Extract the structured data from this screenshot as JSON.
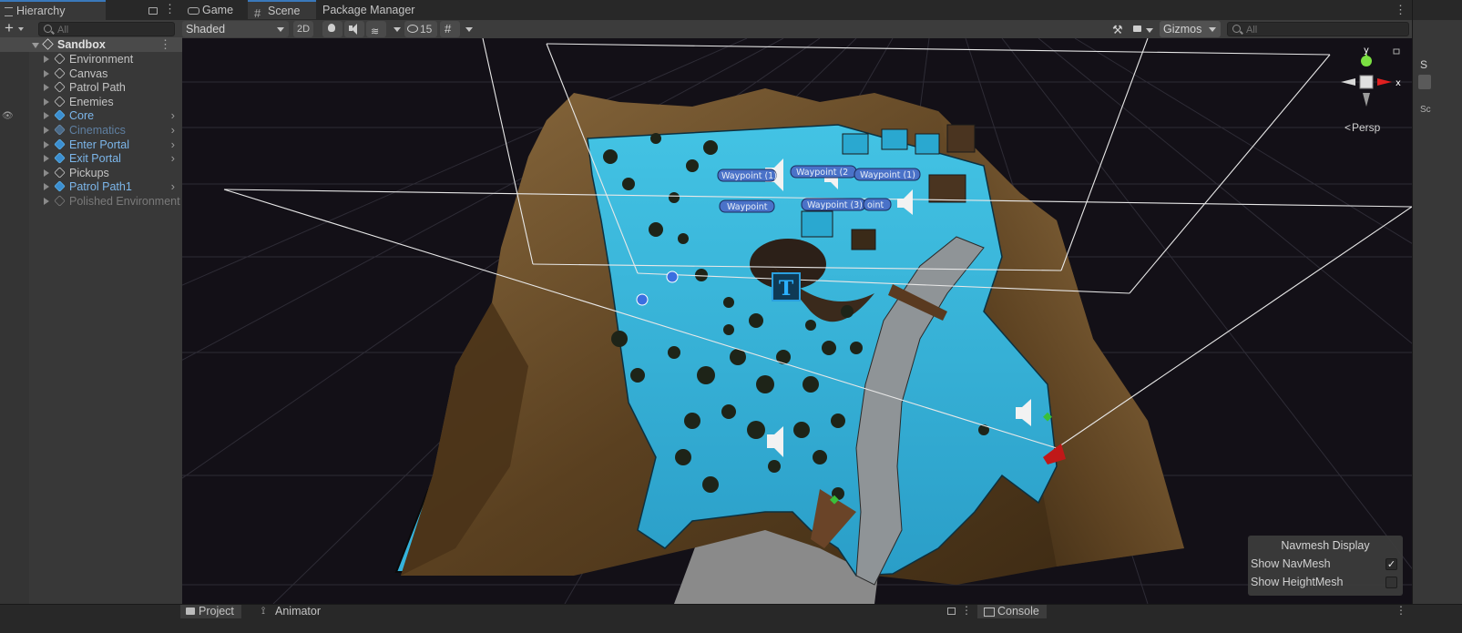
{
  "hierarchy": {
    "tab_label": "Hierarchy",
    "search_placeholder": "All",
    "root": "Sandbox",
    "items": [
      {
        "label": "Environment",
        "color": "#c4c4c4",
        "type": "normal",
        "children": false
      },
      {
        "label": "Canvas",
        "color": "#c4c4c4",
        "type": "normal",
        "children": false
      },
      {
        "label": "Patrol Path",
        "color": "#c4c4c4",
        "type": "normal",
        "children": false
      },
      {
        "label": "Enemies",
        "color": "#c4c4c4",
        "type": "normal",
        "children": false
      },
      {
        "label": "Core",
        "color": "#7cb6ea",
        "type": "prefab",
        "children": true
      },
      {
        "label": "Cinematics",
        "color": "#5f7fa1",
        "type": "prefab-dim",
        "children": true
      },
      {
        "label": "Enter Portal",
        "color": "#7cb6ea",
        "type": "prefab",
        "children": true
      },
      {
        "label": "Exit Portal",
        "color": "#7cb6ea",
        "type": "prefab",
        "children": true
      },
      {
        "label": "Pickups",
        "color": "#c4c4c4",
        "type": "normal",
        "children": false
      },
      {
        "label": "Patrol Path1",
        "color": "#7cb6ea",
        "type": "prefab",
        "children": true
      },
      {
        "label": "Polished Environment",
        "color": "#7a7a7a",
        "type": "disabled",
        "children": false
      }
    ]
  },
  "scene_tabs": {
    "game": "Game",
    "scene": "Scene",
    "package_manager": "Package Manager"
  },
  "toolbar": {
    "draw_mode": "Shaded",
    "two_d": "2D",
    "hidden_count": "15",
    "gizmos": "Gizmos",
    "search_placeholder": "All"
  },
  "viewport": {
    "projection_label": "Persp",
    "axis_y": "y",
    "axis_x": "x",
    "text_marker": "T",
    "waypoints": [
      "Waypoint (1)",
      "Waypoint (2",
      "Waypoint (1)",
      "Waypoint",
      "Waypoint (3)",
      "oint"
    ]
  },
  "navmesh_display": {
    "title": "Navmesh Display",
    "show_navmesh": "Show NavMesh",
    "show_navmesh_checked": true,
    "show_heightmesh": "Show HeightMesh",
    "show_heightmesh_checked": false
  },
  "inspector_stub": {
    "top_letter": "S",
    "bottom_letter": "Sc"
  },
  "bottom_tabs": {
    "project": "Project",
    "animator": "Animator",
    "console": "Console"
  }
}
